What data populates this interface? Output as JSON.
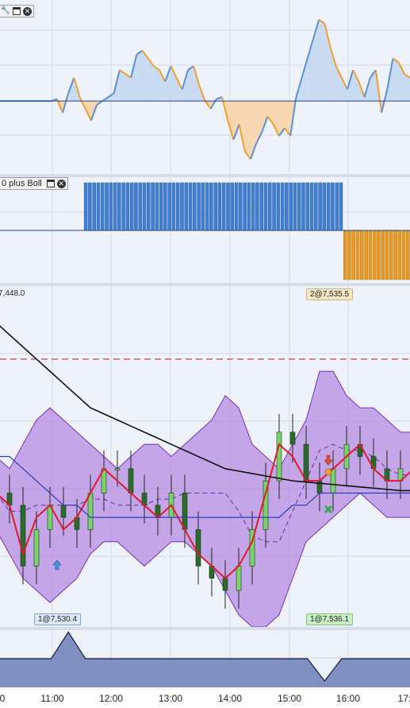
{
  "panel2": {
    "title": "0 plus Boll"
  },
  "price": {
    "top_label": "7,448.0",
    "trades": [
      {
        "label": "1@7,530.4",
        "style": "blue"
      },
      {
        "label": "1@7,536.1",
        "style": "green"
      },
      {
        "label": "2@7,535.5",
        "style": "tan"
      }
    ]
  },
  "xaxis": {
    "ticks": [
      "0",
      "11:00",
      "12:00",
      "13:00",
      "14:00",
      "15:00",
      "16:00",
      "17:"
    ]
  },
  "colors": {
    "osc_up": "#5b8fd6",
    "osc_up_fill": "#c9dbf3",
    "osc_down": "#f0a030",
    "osc_down_fill": "#f7d6b0",
    "hist_up": "#3f7fd0",
    "hist_down": "#e89a1e",
    "bollinger_fill": "#b58be0",
    "bollinger_edge": "#7b2fb8",
    "ma_fast": "#e01a2a",
    "ma_slow": "#2a3fb8",
    "ma_long": "#111111",
    "resistance": "#d42a2a",
    "candle": "#2a8a2a"
  },
  "chart_data": [
    {
      "type": "area",
      "title": "",
      "x": [
        0,
        1,
        2,
        3,
        4,
        5,
        6,
        7,
        8,
        9,
        10,
        11,
        12,
        13,
        14,
        15,
        16,
        17,
        18,
        19,
        20,
        21,
        22,
        23,
        24,
        25,
        26,
        27,
        28,
        29,
        30,
        31,
        32,
        33,
        34,
        35,
        36,
        37,
        38,
        39,
        40,
        41,
        42,
        43,
        44,
        45,
        46,
        47,
        48,
        49,
        50,
        51,
        52,
        53,
        54,
        55,
        56,
        57,
        58,
        59,
        60,
        61,
        62,
        63,
        64,
        65,
        66,
        67,
        68,
        69,
        70,
        71,
        72
      ],
      "values": [
        0,
        0,
        0,
        0,
        0,
        0,
        0,
        0,
        0,
        0,
        0.05,
        -0.3,
        0.2,
        0.6,
        0.1,
        -0.2,
        -0.5,
        -0.1,
        0,
        0.1,
        0.2,
        0.8,
        0.7,
        0.6,
        1.2,
        1.3,
        1.1,
        0.9,
        0.8,
        0.5,
        0.9,
        0.6,
        0.3,
        0.8,
        0.9,
        0.4,
        0,
        -0.2,
        0.05,
        0.1,
        -0.5,
        -1.0,
        -0.6,
        -1.3,
        -1.5,
        -1.1,
        -0.8,
        -0.4,
        -0.6,
        -0.9,
        -0.7,
        -0.9,
        0.1,
        0.6,
        1.1,
        1.6,
        2.1,
        2.0,
        1.4,
        0.9,
        0.6,
        0.3,
        0.8,
        0.5,
        0.1,
        0.6,
        0.8,
        -0.3,
        0.3,
        1.1,
        1.0,
        0.7,
        0.6
      ],
      "ylim": [
        -1.7,
        2.3
      ],
      "baseline": 0
    },
    {
      "type": "bar",
      "title": "0 plus Boll",
      "x": [
        0,
        1,
        2,
        3,
        4,
        5,
        6,
        7,
        8,
        9,
        10,
        11,
        12,
        13,
        14,
        15,
        16,
        17,
        18,
        19,
        20,
        21,
        22,
        23,
        24,
        25,
        26,
        27,
        28,
        29,
        30,
        31,
        32,
        33,
        34,
        35,
        36,
        37,
        38,
        39,
        40,
        41,
        42,
        43,
        44,
        45,
        46,
        47,
        48,
        49,
        50,
        51,
        52,
        53,
        54,
        55,
        56,
        57,
        58,
        59,
        60,
        61,
        62,
        63,
        64,
        65,
        66,
        67,
        68,
        69,
        70,
        71,
        72,
        73,
        74,
        75,
        76,
        77,
        78,
        79,
        80,
        81,
        82,
        83,
        84,
        85,
        86,
        87,
        88,
        89,
        90,
        91,
        92,
        93,
        94,
        95,
        96,
        97
      ],
      "values": [
        0,
        0,
        0,
        0,
        0,
        0,
        0,
        0,
        0,
        0,
        0,
        0,
        0,
        0,
        0,
        0,
        0,
        0,
        0,
        0,
        1,
        1,
        1,
        1,
        1,
        1,
        1,
        1,
        1,
        1,
        1,
        1,
        1,
        1,
        1,
        1,
        1,
        1,
        1,
        1,
        1,
        1,
        1,
        1,
        1,
        1,
        1,
        1,
        1,
        1,
        1,
        1,
        1,
        1,
        1,
        1,
        1,
        1,
        1,
        1,
        1,
        1,
        1,
        1,
        1,
        1,
        1,
        1,
        1,
        1,
        1,
        1,
        1,
        1,
        1,
        1,
        1,
        1,
        1,
        1,
        1,
        1,
        -1,
        -1,
        -1,
        -1,
        -1,
        -1,
        -1,
        -1,
        -1,
        -1,
        -1,
        -1,
        -1,
        -1,
        -1,
        -1
      ],
      "ylim": [
        -1,
        1
      ]
    },
    {
      "type": "line",
      "title": "",
      "resistance": 7545,
      "series": [
        {
          "name": "",
          "style": "bollinger-upper",
          "values": [
            7537,
            7536,
            7538,
            7540,
            7541,
            7540,
            7539,
            7538,
            7537,
            7536,
            7537,
            7538,
            7538,
            7537,
            7538,
            7539,
            7540,
            7542,
            7541,
            7538,
            7537,
            7536,
            7538,
            7540,
            7544,
            7544,
            7542,
            7541,
            7541,
            7540,
            7539,
            7539
          ]
        },
        {
          "name": "",
          "style": "bollinger-lower",
          "values": [
            7531,
            7529,
            7527,
            7526,
            7525,
            7526,
            7527,
            7529,
            7530,
            7530,
            7529,
            7528,
            7529,
            7530,
            7530,
            7529,
            7528,
            7526,
            7524,
            7523,
            7523,
            7524,
            7527,
            7530,
            7531,
            7532,
            7533,
            7534,
            7533,
            7532,
            7532,
            7532
          ]
        },
        {
          "name": "",
          "style": "ma-fast",
          "values": [
            7534,
            7533,
            7529,
            7532,
            7533,
            7531,
            7532,
            7534,
            7536,
            7535,
            7534,
            7533,
            7532,
            7533,
            7531,
            7529,
            7528,
            7527,
            7528,
            7530,
            7534,
            7538,
            7537,
            7535,
            7535,
            7536,
            7537,
            7538,
            7536,
            7535,
            7535,
            7536
          ]
        },
        {
          "name": "",
          "style": "ma-slow",
          "values": [
            7537,
            7537,
            7536,
            7535,
            7534,
            7533,
            7533,
            7532,
            7532,
            7532,
            7532,
            7532,
            7532,
            7532,
            7532,
            7532,
            7532,
            7532,
            7532,
            7532,
            7532,
            7532,
            7533,
            7533,
            7534,
            7534,
            7534,
            7534,
            7534,
            7534,
            7534,
            7534
          ]
        },
        {
          "name": "",
          "style": "ma-long",
          "values": [
            7548,
            7547,
            7546,
            7545,
            7544,
            7543,
            7542,
            7541,
            7540.5,
            7540,
            7539.5,
            7539,
            7538.5,
            7538,
            7537.5,
            7537,
            7536.5,
            7536,
            7535.8,
            7535.6,
            7535.4,
            7535.2,
            7535,
            7534.9,
            7534.8,
            7534.7,
            7534.6,
            7534.5,
            7534.4,
            7534.3,
            7534.2,
            7534.2
          ]
        }
      ],
      "candles": {
        "close": [
          7534,
          7533,
          7528,
          7531,
          7533,
          7532,
          7531,
          7534,
          7536,
          7536,
          7534,
          7533,
          7532,
          7534,
          7531,
          7528,
          7527,
          7526,
          7528,
          7531,
          7535,
          7539,
          7538,
          7535,
          7534,
          7536,
          7538,
          7537,
          7536,
          7535,
          7536,
          7537
        ]
      },
      "ylim": [
        7523,
        7551
      ]
    },
    {
      "type": "area",
      "title": "",
      "x": [
        0,
        1,
        2,
        3,
        4,
        5,
        6,
        7,
        8,
        9,
        10,
        11,
        12,
        13,
        14,
        15,
        16,
        17,
        18,
        19,
        20,
        21,
        22,
        23,
        24
      ],
      "values": [
        0,
        0,
        0,
        0,
        1.2,
        0,
        0,
        0,
        0,
        0,
        0,
        0,
        0,
        0,
        0,
        0,
        0,
        0,
        0,
        -1,
        0,
        0,
        0,
        0,
        0
      ],
      "ylim": [
        -1.3,
        1.3
      ]
    }
  ]
}
